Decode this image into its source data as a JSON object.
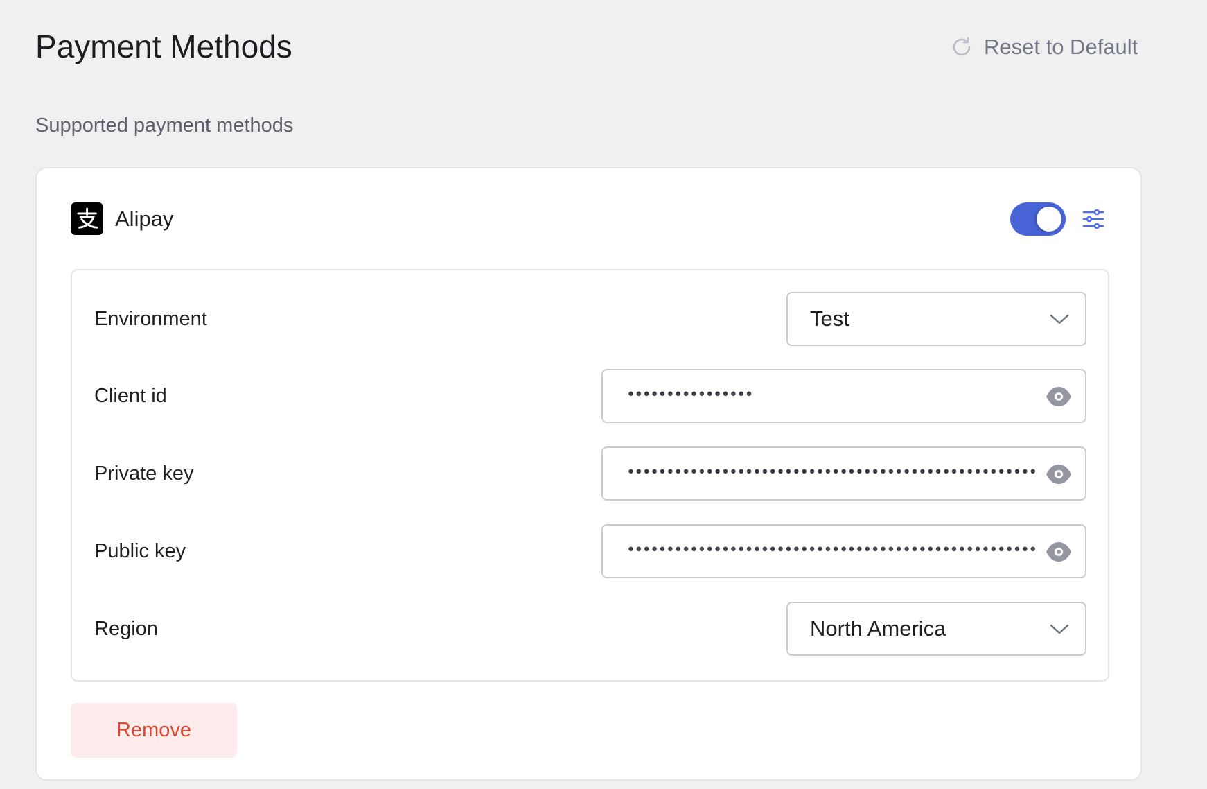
{
  "header": {
    "title": "Payment Methods",
    "reset_label": "Reset to Default",
    "reset_icon": "refresh-icon"
  },
  "subtitle": "Supported payment methods",
  "colors": {
    "accent": "#4763d6",
    "danger": "#e0452f",
    "danger_bg": "#fdeceb",
    "muted": "#737886"
  },
  "method": {
    "name": "Alipay",
    "logo_glyph": "支",
    "enabled": true,
    "fields": [
      {
        "label": "Environment",
        "type": "select",
        "value": "Test"
      },
      {
        "label": "Client id",
        "type": "password",
        "value": "••••••••••••••••"
      },
      {
        "label": "Private key",
        "type": "password",
        "value": "•••••••••••••••••••••••••••••••••••••••••••••••••••••••••••••••"
      },
      {
        "label": "Public key",
        "type": "password",
        "value": "•••••••••••••••••••••••••••••••••••••••••••••••••••••••••••••••"
      },
      {
        "label": "Region",
        "type": "select",
        "value": "North America"
      }
    ],
    "remove_label": "Remove"
  }
}
